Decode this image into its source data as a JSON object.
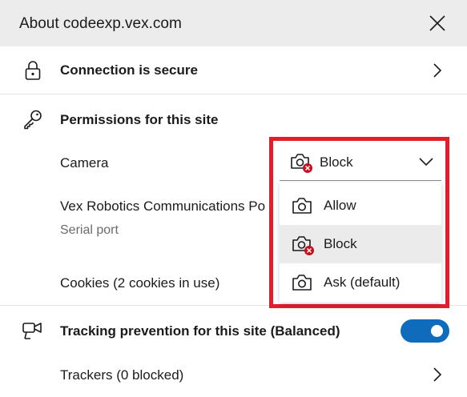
{
  "header": {
    "title": "About codeexp.vex.com"
  },
  "connection": {
    "label": "Connection is secure"
  },
  "permissions": {
    "heading": "Permissions for this site",
    "camera": {
      "label": "Camera",
      "selected": "Block"
    },
    "serial": {
      "label": "Vex Robotics Communications Po",
      "sublabel": "Serial port"
    },
    "cookies": {
      "label": "Cookies (2 cookies in use)"
    }
  },
  "dropdown": {
    "options": [
      {
        "label": "Allow",
        "icon": "camera-icon"
      },
      {
        "label": "Block",
        "icon": "camera-blocked-icon",
        "selected": true
      },
      {
        "label": "Ask (default)",
        "icon": "camera-icon"
      }
    ]
  },
  "tracking": {
    "label": "Tracking prevention for this site (Balanced)",
    "enabled": true
  },
  "trackers": {
    "label": "Trackers (0 blocked)"
  },
  "colors": {
    "highlight": "#e41c2b",
    "toggle_on": "#0f6cbd",
    "header_bg": "#ececec"
  }
}
